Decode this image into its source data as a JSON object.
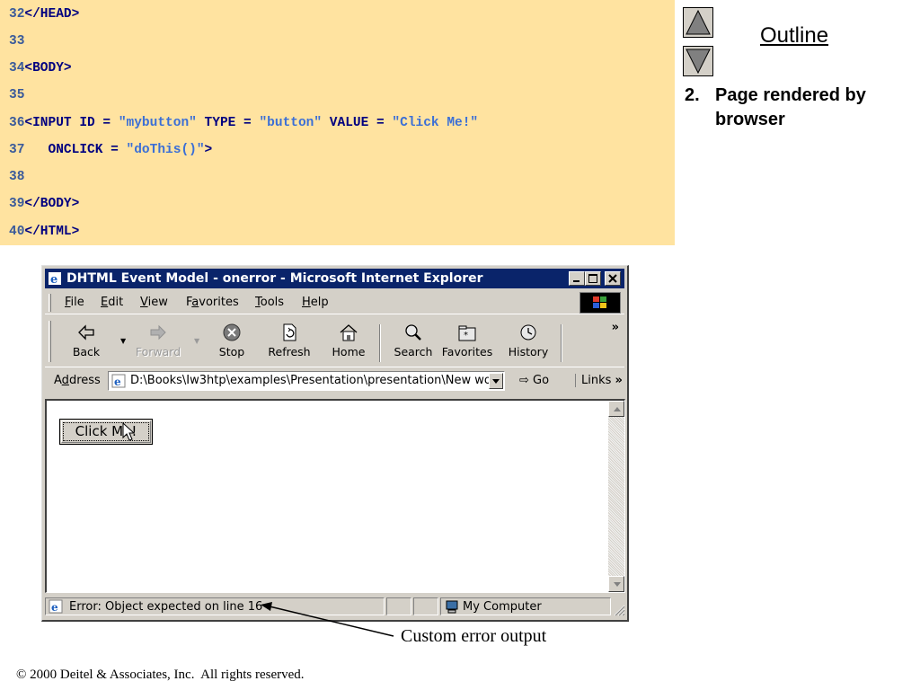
{
  "code": {
    "lines": [
      {
        "num": "32",
        "text": "</HEAD>"
      },
      {
        "num": "33",
        "text": ""
      },
      {
        "num": "34",
        "text": "<BODY>"
      },
      {
        "num": "35",
        "text": ""
      },
      {
        "num": "36",
        "pre": "<INPUT ID = ",
        "s1": "\"mybutton\"",
        "mid1": " TYPE = ",
        "s2": "\"button\"",
        "mid2": " VALUE = ",
        "s3": "\"Click Me!\""
      },
      {
        "num": "37",
        "pre": "   ONCLICK = ",
        "s1": "\"doThis()\"",
        "post": ">"
      },
      {
        "num": "38",
        "text": ""
      },
      {
        "num": "39",
        "text": "</BODY>"
      },
      {
        "num": "40",
        "text": "</HTML>"
      }
    ]
  },
  "outline": {
    "link": "Outline",
    "bullet_num": "2.",
    "bullet_text": "Page rendered by browser"
  },
  "browser": {
    "title": "DHTML Event Model - onerror - Microsoft Internet Explorer",
    "menu": {
      "file": {
        "u": "F",
        "rest": "ile"
      },
      "edit": {
        "u": "E",
        "rest": "dit"
      },
      "view": {
        "u": "V",
        "rest": "iew"
      },
      "favorites": {
        "pre": "F",
        "u": "a",
        "rest": "vorites"
      },
      "tools": {
        "u": "T",
        "rest": "ools"
      },
      "help": {
        "u": "H",
        "rest": "elp"
      }
    },
    "toolbar": {
      "back": "Back",
      "forward": "Forward",
      "stop": "Stop",
      "refresh": "Refresh",
      "home": "Home",
      "search": "Search",
      "favorites": "Favorites",
      "history": "History",
      "more": "»"
    },
    "address": {
      "label_pre": "A",
      "label_u": "d",
      "label_rest": "dress",
      "value": "D:\\Books\\Iw3htp\\examples\\Presentation\\presentation\\New wor",
      "go": "Go",
      "links": "Links",
      "links_more": "»"
    },
    "page": {
      "button_label": "Click Me!"
    },
    "status": {
      "text": "Error: Object expected on line 16",
      "zone": "My Computer"
    }
  },
  "annotation": {
    "label": "Custom error output"
  },
  "footer": {
    "copyright": "© 2000 Deitel & Associates, Inc.  All rights reserved."
  }
}
